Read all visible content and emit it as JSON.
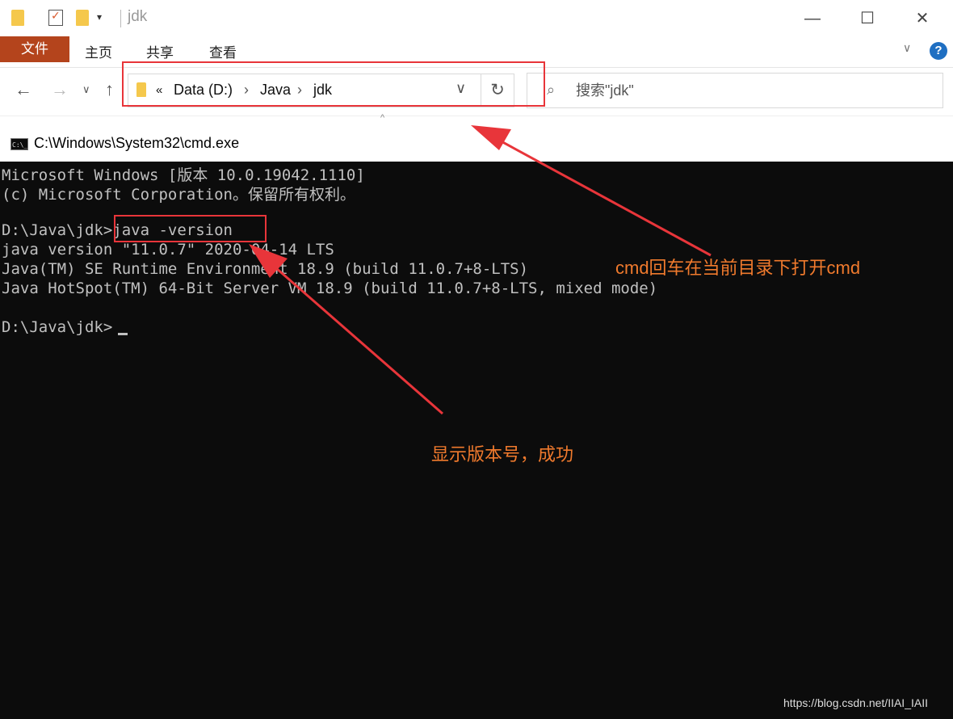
{
  "explorer": {
    "window_title": "jdk",
    "quick_access": {
      "dropdown_glyph": "▾"
    },
    "controls": {
      "minimize": "—",
      "maximize": "☐",
      "close": "✕"
    },
    "ribbon": {
      "file_tab": "文件",
      "tabs": [
        "主页",
        "共享",
        "查看"
      ],
      "expand_glyph": "∨",
      "help_glyph": "?"
    },
    "nav": {
      "back": "←",
      "forward": "→",
      "recent": "∨",
      "up": "↑"
    },
    "address": {
      "overflow": "«",
      "segments": [
        "Data (D:)",
        "Java",
        "jdk"
      ],
      "separator": "›",
      "dropdown": "∨",
      "refresh": "↻"
    },
    "search": {
      "icon": "⌕",
      "placeholder": "搜索\"jdk\""
    },
    "header_caret": "^"
  },
  "cmd": {
    "title": "C:\\Windows\\System32\\cmd.exe",
    "icon_text": "C:\\_",
    "lines": [
      "Microsoft Windows [版本 10.0.19042.1110]",
      "(c) Microsoft Corporation。保留所有权利。",
      "",
      "D:\\Java\\jdk>java -version",
      "java version \"11.0.7\" 2020-04-14 LTS",
      "Java(TM) SE Runtime Environment 18.9 (build 11.0.7+8-LTS)",
      "Java HotSpot(TM) 64-Bit Server VM 18.9 (build 11.0.7+8-LTS, mixed mode)",
      "",
      "D:\\Java\\jdk>"
    ]
  },
  "annotations": {
    "address_note": "cmd回车在当前目录下打开cmd",
    "version_note": "显示版本号，成功",
    "color": "#f07a2d",
    "highlight_color": "#e8353a"
  },
  "watermark": "https://blog.csdn.net/IIAI_IAII"
}
